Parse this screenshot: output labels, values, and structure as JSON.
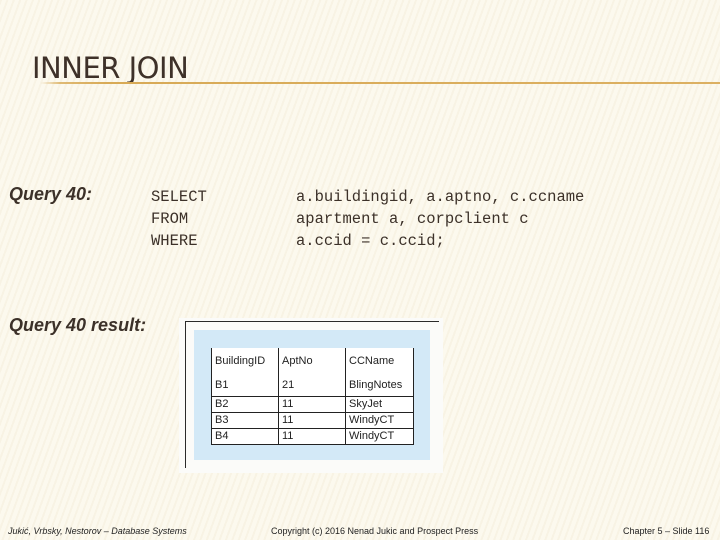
{
  "slide": {
    "title": "INNER JOIN",
    "query_label": "Query 40:",
    "sql": {
      "keywords": [
        "SELECT",
        "FROM",
        "WHERE"
      ],
      "clauses": [
        "a.buildingid, a.aptno, c.ccname",
        "apartment a, corpclient c",
        "a.ccid = c.ccid;"
      ]
    },
    "result_label": "Query 40 result:",
    "result_table": {
      "columns": [
        "BuildingID",
        "AptNo",
        "CCName"
      ],
      "rows": [
        [
          "B1",
          "21",
          "BlingNotes"
        ],
        [
          "B2",
          "11",
          "SkyJet"
        ],
        [
          "B3",
          "11",
          "WindyCT"
        ],
        [
          "B4",
          "11",
          "WindyCT"
        ]
      ]
    }
  },
  "footer": {
    "authors": "Jukić, Vrbsky, Nestorov – Database Systems",
    "copyright": "Copyright (c) 2016 Nenad Jukic and Prospect Press",
    "slide_number": "Chapter 5 – Slide 116"
  },
  "colors": {
    "background": "#fcf9ee",
    "title_rule": "#d8aa56",
    "text": "#3c3129",
    "result_panel": "#d3e9f7"
  }
}
